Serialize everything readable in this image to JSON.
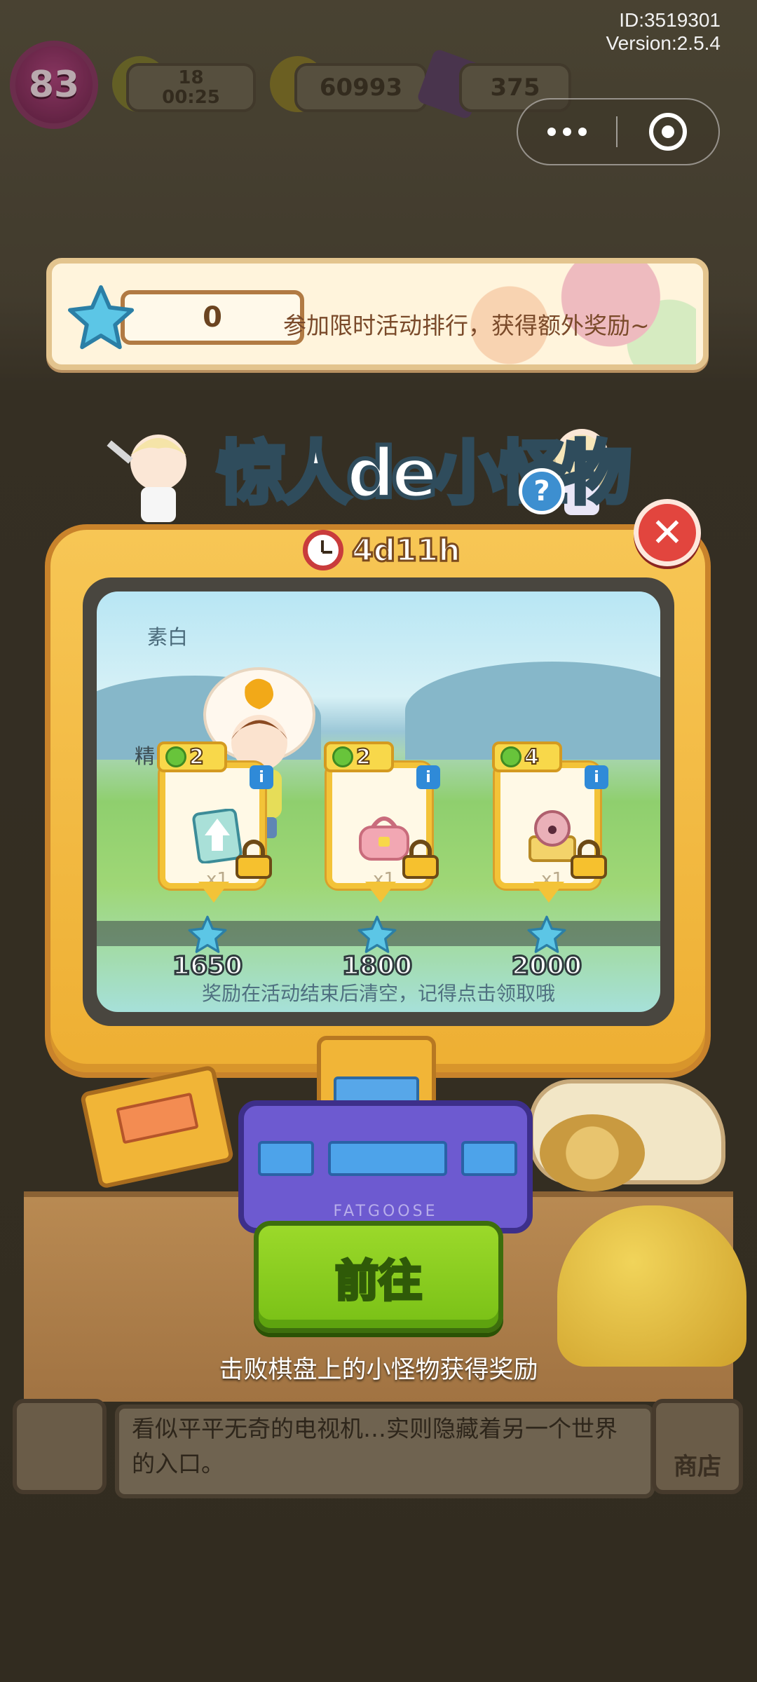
{
  "system": {
    "id_label": "ID:3519301",
    "version_label": "Version:2.5.4"
  },
  "hud": {
    "level": "83",
    "energy_value": "18",
    "energy_timer": "00:25",
    "coins": "60993",
    "gems": "375"
  },
  "capsule": {
    "more_icon": "more-dots-icon",
    "close_icon": "target-circle-icon"
  },
  "banner": {
    "score": "0",
    "text": "参加限时活动排行，获得额外奖励~"
  },
  "event": {
    "title": "惊人de小怪物",
    "timer": "4d11h",
    "character_name": "素白",
    "side_name": "精",
    "notice": "奖励在活动结束后清空，记得点击领取哦",
    "rewards": [
      {
        "tier": "2",
        "qty": "x1",
        "milestone": "1650",
        "item": "card-upgrade-icon"
      },
      {
        "tier": "2",
        "qty": "x1",
        "milestone": "1800",
        "item": "bag-icon"
      },
      {
        "tier": "4",
        "qty": "x1",
        "milestone": "2000",
        "item": "monster-chest-icon"
      }
    ],
    "console_brand": "FATGOOSE",
    "go_button": "前往",
    "hint": "击败棋盘上的小怪物获得奖励"
  },
  "background": {
    "description": "看似平平无奇的电视机…实则隐藏着另一个世界的入口。",
    "shop_label": "商店"
  },
  "colors": {
    "accent_yellow": "#f3c338",
    "go_green": "#79c016",
    "close_red": "#e2453e",
    "star_blue": "#5cc6e6"
  }
}
